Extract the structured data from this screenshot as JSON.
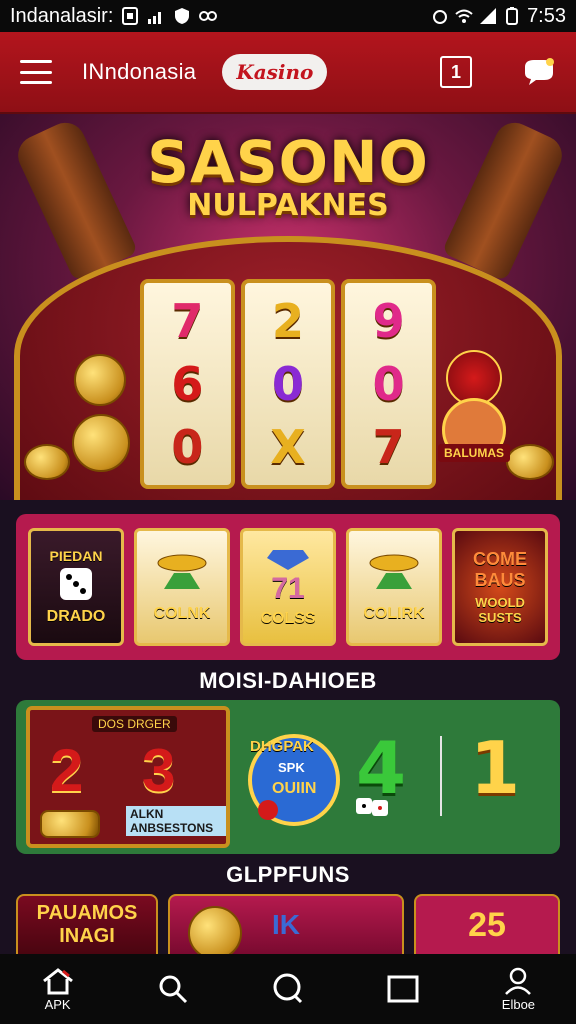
{
  "status_bar": {
    "carrier": "Indanalasir:",
    "time": "7:53"
  },
  "header": {
    "brand": "INndonasia",
    "logo": "Kasino",
    "notification_count": "1"
  },
  "hero": {
    "title": "SASONO",
    "subtitle": "NULPAKNES",
    "reels": [
      [
        "7",
        "6",
        "0"
      ],
      [
        "2",
        "0",
        "X"
      ],
      [
        "9",
        "0",
        "7"
      ]
    ],
    "mascot_label": "BALUMAS"
  },
  "row1": {
    "tiles": [
      {
        "line1": "PIEDAN",
        "line2": "DRADO"
      },
      {
        "line1": "",
        "line2": "COLNK"
      },
      {
        "line1": "71",
        "line2": "COLSS"
      },
      {
        "line1": "",
        "line2": "COLIRK"
      },
      {
        "line1": "COME BAUS",
        "line2": "WOOLD SUSTS"
      }
    ]
  },
  "section_title_1": "MOISI-DAHIOEB",
  "row2": {
    "slot_caption": "DOS DRGER",
    "slot_numbers": [
      "2",
      "3"
    ],
    "slot_label": "ALKN ANBSESTONS",
    "badge_line1": "DHGPAK",
    "badge_line2": "SPK",
    "badge_line3": "OUIIN",
    "num_a": "4",
    "num_b": "1"
  },
  "section_title_2": "GLPPFUNS",
  "row3": {
    "tiles": [
      "PAUAMOS INAGI",
      "IK",
      "25"
    ]
  },
  "bottom_nav": {
    "items": [
      {
        "label": "APK",
        "icon": "home-icon"
      },
      {
        "label": "",
        "icon": "search-icon"
      },
      {
        "label": "",
        "icon": "chat-icon"
      },
      {
        "label": "",
        "icon": "square-icon"
      },
      {
        "label": "Elboe",
        "icon": "user-icon"
      }
    ]
  },
  "colors": {
    "header_red": "#b3151d",
    "tile_magenta": "#b51a4e",
    "tile_green": "#2e7a3a",
    "gold": "#ffd34a"
  }
}
